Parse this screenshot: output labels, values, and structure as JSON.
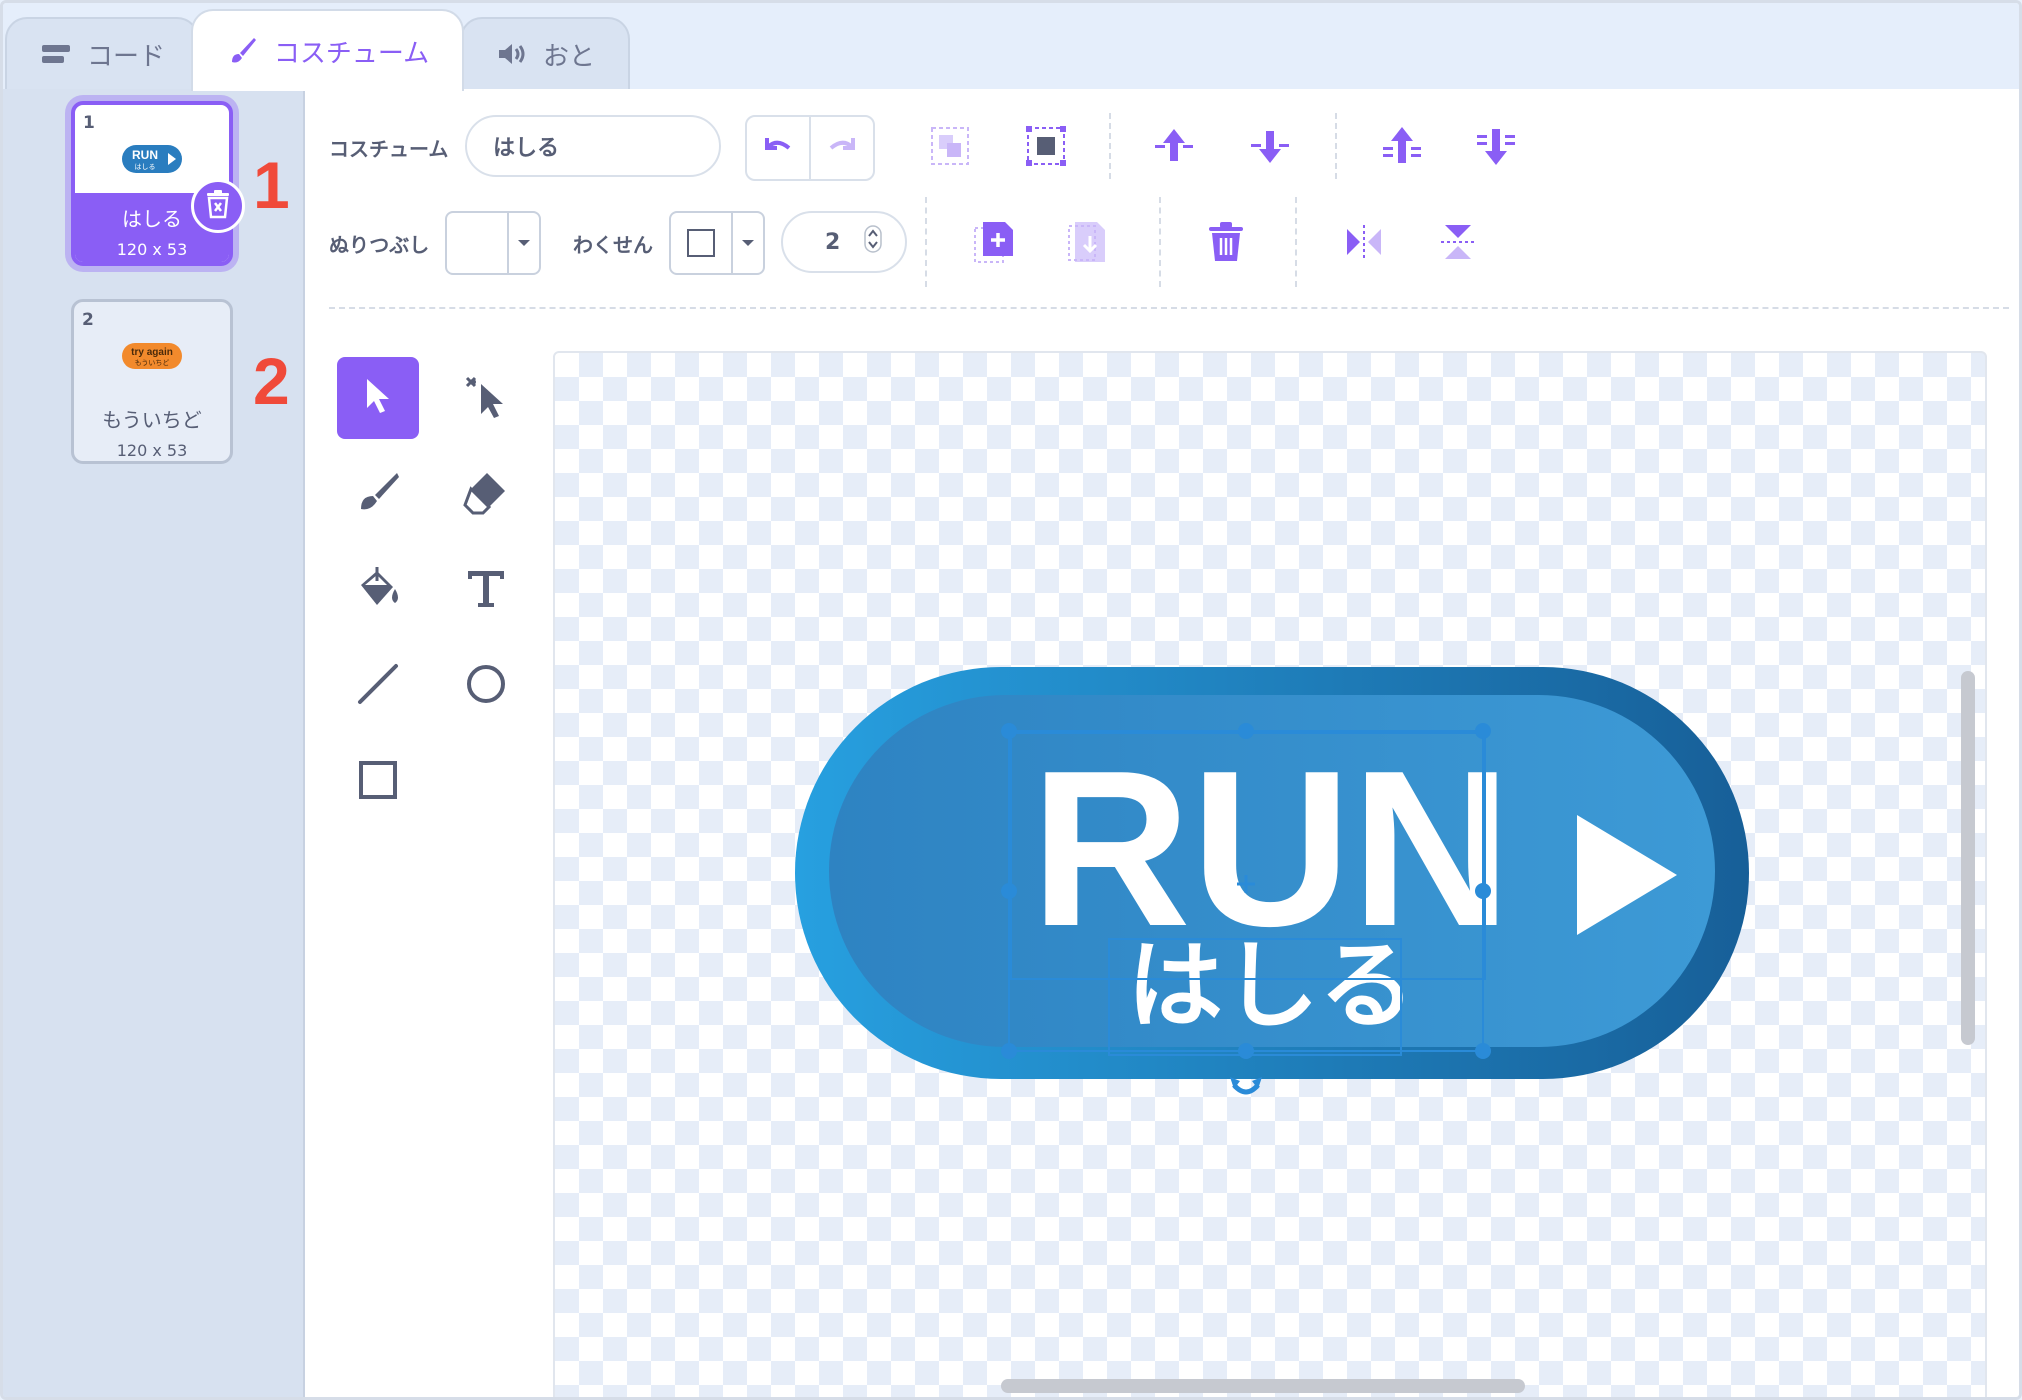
{
  "tabs": [
    {
      "label": "コード",
      "icon": "code-blocks-icon"
    },
    {
      "label": "コスチューム",
      "icon": "paintbrush-icon"
    },
    {
      "label": "おと",
      "icon": "speaker-icon"
    }
  ],
  "costumes": [
    {
      "number": "1",
      "name": "はしる",
      "size": "120 x 53",
      "thumb_text": "RUN",
      "thumb_sub": "はしる",
      "selected": true
    },
    {
      "number": "2",
      "name": "もういちど",
      "size": "120 x 53",
      "thumb_text": "try again",
      "thumb_sub": "もういちど",
      "selected": false
    }
  ],
  "callouts": [
    "1",
    "2"
  ],
  "toolbar": {
    "costume_label": "コスチューム",
    "costume_name": "はしる",
    "fill_label": "ぬりつぶし",
    "outline_label": "わくせん",
    "outline_width": "2"
  },
  "canvas": {
    "button_text": "RUN",
    "button_sub": "はしる"
  },
  "colors": {
    "accent": "#8a5ef5",
    "callout": "#f04a3a",
    "run_blue_dark": "#1c5f9c",
    "run_blue_light": "#3d98d6"
  }
}
